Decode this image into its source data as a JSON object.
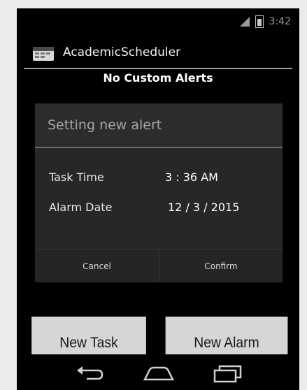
{
  "status_bar": {
    "signal": "signal-icon",
    "battery": "battery-icon",
    "time": "3:42"
  },
  "action_bar": {
    "app_icon": "app-launcher-icon",
    "title": "AcademicScheduler"
  },
  "header": {
    "label": "No Custom Alerts"
  },
  "dialog": {
    "title": "Setting new alert",
    "task_time_label": "Task Time",
    "task_time_value": "3 : 36 AM",
    "alarm_date_label": "Alarm Date",
    "alarm_date_value": "12 / 3 / 2015",
    "cancel_label": "Cancel",
    "confirm_label": "Confirm"
  },
  "buttons": {
    "new_task_label": "New Task",
    "new_alarm_label": "New Alarm"
  },
  "nav_bar": {
    "back": "back-icon",
    "home": "home-icon",
    "recents": "recents-icon"
  }
}
